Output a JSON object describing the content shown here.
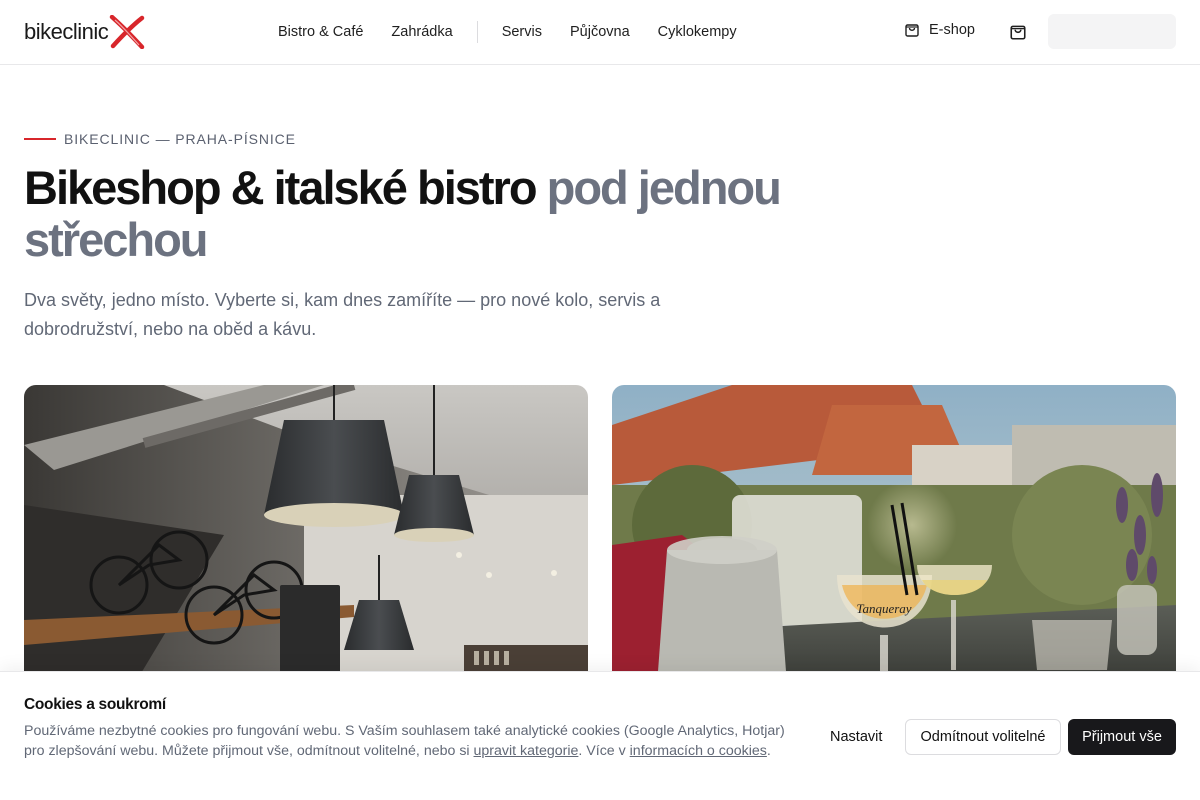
{
  "header": {
    "logo_text": "bikeclinic",
    "logo_mark_icon": "x-mark-icon",
    "nav": {
      "bistro": "Bistro & Café",
      "zahradka": "Zahrádka",
      "servis": "Servis",
      "pujcovna": "Půjčovna",
      "cyklokempy": "Cyklokempy"
    },
    "shop_label": "E-shop",
    "shop_icon": "shopping-bag-icon",
    "cart_icon": "shopping-bag-icon"
  },
  "hero": {
    "eyebrow": "BIKECLINIC — PRAHA-PÍSNICE",
    "headline_main": "Bikeshop & italské bistro",
    "headline_muted": "pod jednou střechou",
    "lead": "Dva světy, jedno místo. Vyberte si, kam dnes zamíříte — pro nové kolo, servis a dobrodružství, nebo na oběd a kávu."
  },
  "cards": {
    "left_image": "bikeshop-interior-photo",
    "right_image": "bistro-terrace-drinks-photo",
    "right_glass_text": "Tanqueray"
  },
  "cookie": {
    "title": "Cookies a soukromí",
    "text_1": "Používáme nezbytné cookies pro fungování webu. S Vaším souhlasem také analytické cookies (Google Analytics, Hotjar) pro zlepšování webu. Můžete přijmout vše, odmítnout volitelné, nebo si ",
    "link_categories": "upravit kategorie",
    "text_2": ". Více v ",
    "link_info": "informacích o cookies",
    "text_3": ".",
    "btn_settings": "Nastavit",
    "btn_reject": "Odmítnout volitelné",
    "btn_accept": "Přijmout vše"
  },
  "colors": {
    "accent_red": "#d8262b",
    "muted_text": "#616876",
    "primary_button": "#18181b"
  }
}
